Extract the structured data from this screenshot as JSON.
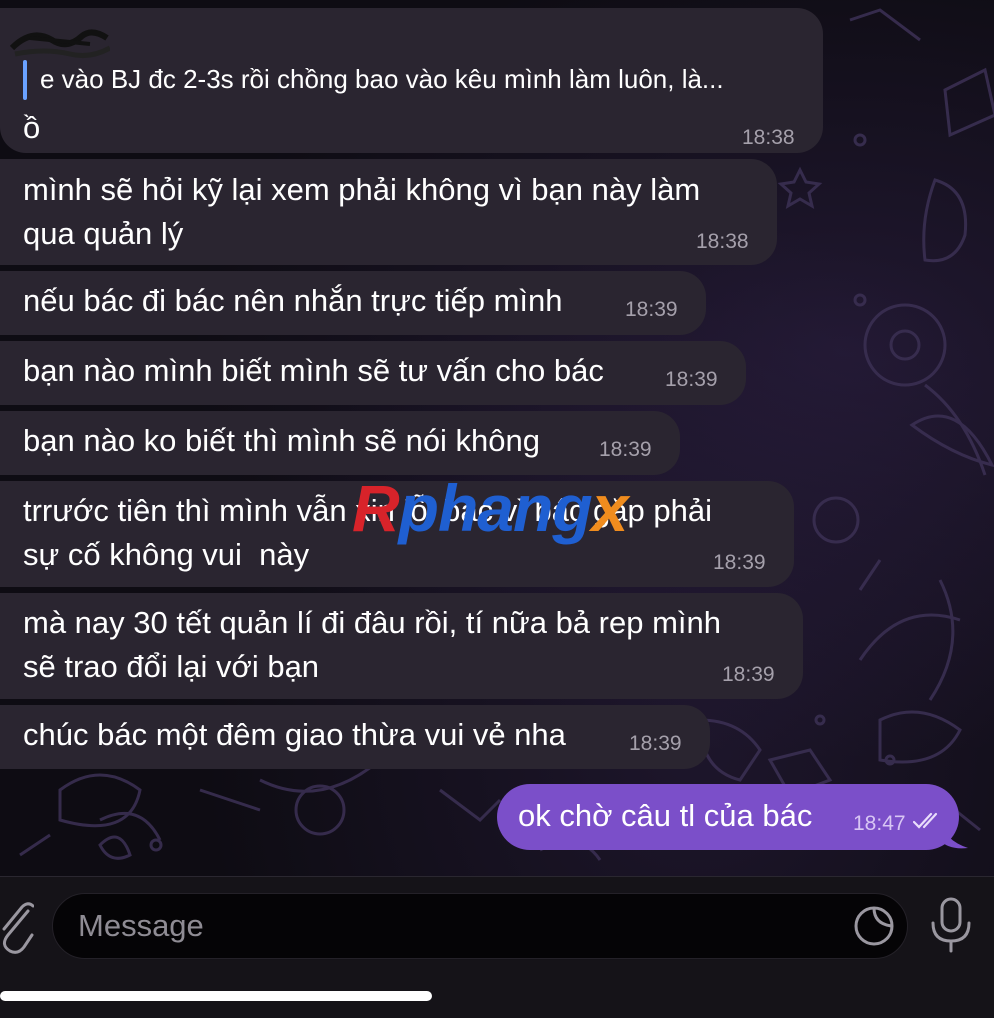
{
  "messages": [
    {
      "reply_preview": "e vào BJ đc 2-3s rồi chồng bao vào kêu mình làm luôn, là...",
      "lines": [
        "ồ"
      ],
      "time": "18:38"
    },
    {
      "lines": [
        "mình sẽ hỏi kỹ lại xem phải không vì bạn này làm",
        "qua quản lý"
      ],
      "time": "18:38"
    },
    {
      "lines": [
        "nếu bác đi bác nên nhắn trực tiếp mình"
      ],
      "time": "18:39"
    },
    {
      "lines": [
        "bạn nào mình biết mình sẽ tư vấn cho bác"
      ],
      "time": "18:39"
    },
    {
      "lines": [
        "bạn nào ko biết thì mình sẽ nói không"
      ],
      "time": "18:39"
    },
    {
      "lines": [
        "trrước tiên thì mình vẫn xin lỗi bác vì bác gặp phải",
        "sự cố không vui  này"
      ],
      "time": "18:39"
    },
    {
      "lines": [
        "mà nay 30 tết quản lí đi đâu rồi, tí nữa bả rep mình",
        "sẽ trao đổi lại với bạn"
      ],
      "time": "18:39"
    },
    {
      "lines": [
        "chúc bác một đêm giao thừa vui vẻ nha"
      ],
      "time": "18:39"
    }
  ],
  "outgoing": {
    "text": "ok chờ câu tl của bác",
    "time": "18:47",
    "status_icon": "double-check-icon"
  },
  "watermark": {
    "r": "R",
    "mid": "phang",
    "x": "x"
  },
  "input": {
    "placeholder": "Message"
  },
  "icons": {
    "attach": "paperclip-icon",
    "sticker": "sticker-icon",
    "mic": "microphone-icon"
  },
  "colors": {
    "incoming_bubble": "#2a2530",
    "outgoing_bubble": "#7b4fc9",
    "reply_accent": "#6aa2ff"
  }
}
